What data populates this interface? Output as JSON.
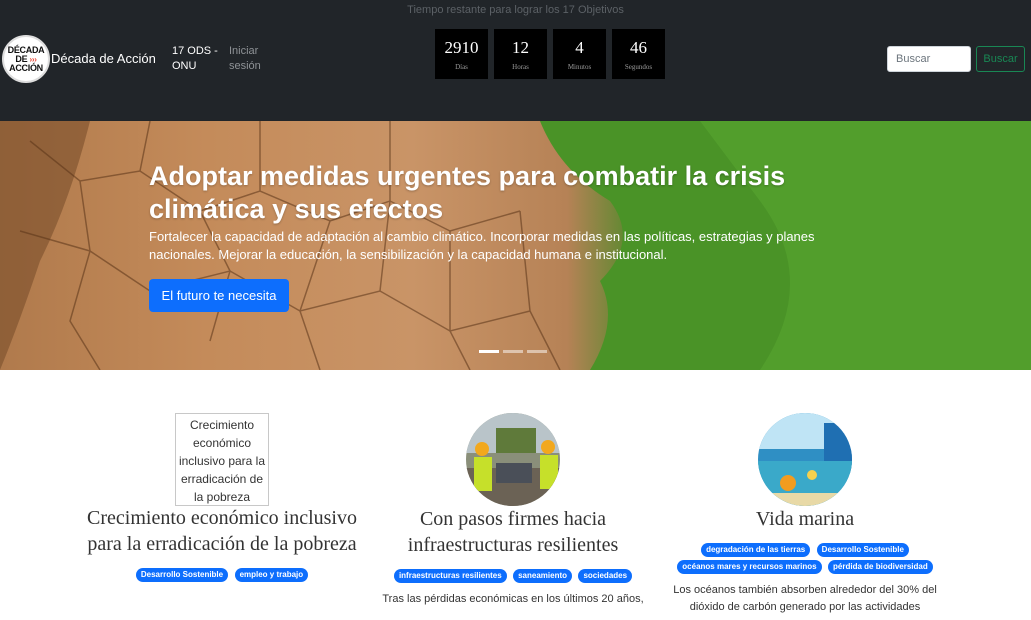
{
  "header": {
    "countdown_caption": "Tiempo restante para lograr los 17 Objetivos",
    "logo_lines": [
      "DÉCADA",
      "DE",
      "ACCIÓN"
    ],
    "logo_arrows": "›››",
    "brand": "Década de Acción",
    "nav": {
      "ods": "17 ODS - ONU",
      "login": "Iniciar sesión"
    },
    "timer": [
      {
        "value": "2910",
        "label": "Días"
      },
      {
        "value": "12",
        "label": "Horas"
      },
      {
        "value": "4",
        "label": "Minutos"
      },
      {
        "value": "46",
        "label": "Segundos"
      }
    ],
    "search": {
      "placeholder": "Buscar",
      "button": "Buscar"
    }
  },
  "hero": {
    "title": "Adoptar medidas urgentes para combatir la crisis climática y sus efectos",
    "text": "Fortalecer la capacidad de adaptación al cambio climático. Incorporar medidas en las políticas, estrategias y planes nacionales. Mejorar la educación, la sensibilización y la capacidad humana e institucional.",
    "button": "El futuro te necesita",
    "active_slide": 1,
    "slide_count": 3
  },
  "columns": [
    {
      "image_alt": "Crecimiento económico inclusivo para la erradicación de la pobreza",
      "title": "Crecimiento económico inclusivo para la erradicación de la pobreza",
      "badges": [
        "Desarrollo Sostenible",
        "empleo y trabajo"
      ],
      "text": ""
    },
    {
      "title": "Con pasos firmes hacia infraestructuras resilientes",
      "badges": [
        "infraestructuras resilientes",
        "saneamiento",
        "sociedades"
      ],
      "text": "Tras las pérdidas económicas en los últimos 20 años,"
    },
    {
      "title": "Vida marina",
      "badges": [
        "degradación de las tierras",
        "Desarrollo Sostenible",
        "océanos mares y recursos marinos",
        "pérdida de biodiversidad"
      ],
      "text": "Los océanos también absorben alrededor del 30% del dióxido de carbón generado por las actividades"
    }
  ]
}
